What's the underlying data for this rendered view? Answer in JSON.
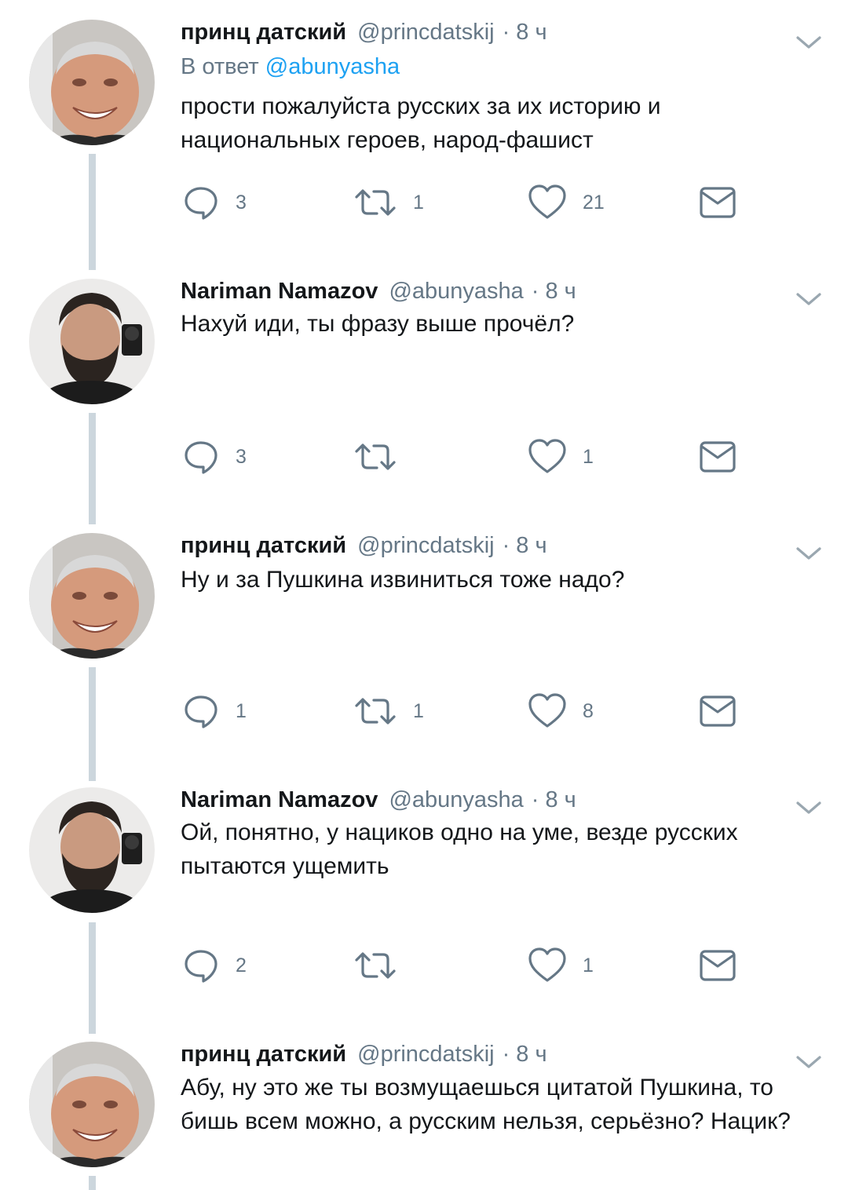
{
  "tweets": [
    {
      "name": "принц датский",
      "handle": "@princdatskij",
      "time": "8 ч",
      "reply_prefix": "В ответ",
      "reply_mention": "@abunyasha",
      "text_lines": [
        "прости пожалуйста русских за их историю и",
        "национальных героев, народ-фашист"
      ],
      "replies": "3",
      "retweets": "1",
      "likes": "21"
    },
    {
      "name": "Nariman Namazov",
      "handle": "@abunyasha",
      "time": "8 ч",
      "text_lines": [
        "Нахуй иди, ты фразу выше прочёл?"
      ],
      "replies": "3",
      "retweets": "",
      "likes": "1"
    },
    {
      "name": "принц датский",
      "handle": "@princdatskij",
      "time": "8 ч",
      "text_lines": [
        "Ну и за Пушкина извиниться тоже надо?"
      ],
      "replies": "1",
      "retweets": "1",
      "likes": "8"
    },
    {
      "name": "Nariman Namazov",
      "handle": "@abunyasha",
      "time": "8 ч",
      "text_lines": [
        "Ой, понятно, у нациков одно на уме, везде русских",
        "пытаются ущемить"
      ],
      "replies": "2",
      "retweets": "",
      "likes": "1"
    },
    {
      "name": "принц датский",
      "handle": "@princdatskij",
      "time": "8 ч",
      "text_lines": [
        "Абу, ну это же ты возмущаешься цитатой Пушкина, то",
        "бишь всем можно, а русским нельзя, серьёзно? Нацик?"
      ]
    }
  ],
  "colors": {
    "text": "#14171a",
    "secondary": "#657786",
    "link": "#1da1f2",
    "thread_line": "#ccd6dd"
  },
  "icons": {
    "reply": "reply-icon",
    "retweet": "retweet-icon",
    "like": "heart-icon",
    "dm": "envelope-icon",
    "menu": "chevron-down-icon"
  }
}
